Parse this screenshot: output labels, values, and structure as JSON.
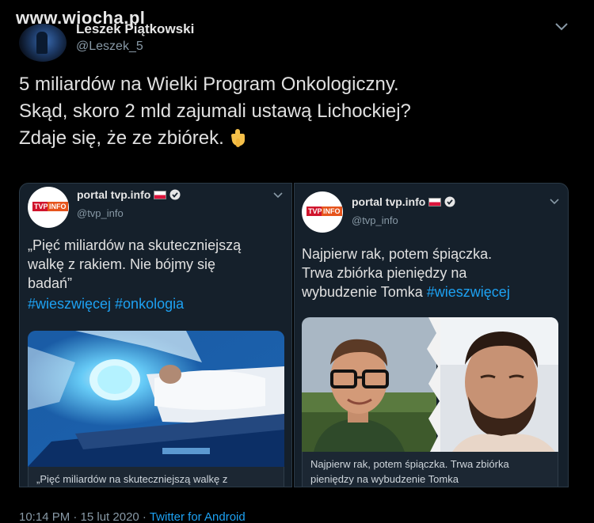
{
  "watermark": {
    "text": "www.wiocha.pl"
  },
  "author": {
    "name": "Leszek Piątkowski",
    "handle": "@Leszek_5"
  },
  "tweet": {
    "lines": [
      "5 miliardów na Wielki Program Onkologiczny.",
      "Skąd, skoro 2 mld zajumali ustawą Lichockiej?",
      "Zdaje się, że ze zbiórek."
    ],
    "emoji": "pointing-down-hand"
  },
  "cards": [
    {
      "name": "portal tvp.info",
      "handle": "@tvp_info",
      "logo_text_a": "TVP",
      "logo_text_b": "INFO",
      "text_lines": [
        "„Pięć miliardów na skuteczniejszą",
        "walkę z rakiem. Nie bójmy się",
        "badań”"
      ],
      "hashtags": "#wieszwięcej #onkologia",
      "caption": "„Pięć miliardów na skuteczniejszą walkę z"
    },
    {
      "name": "portal tvp.info",
      "handle": "@tvp_info",
      "logo_text_a": "TVP",
      "logo_text_b": "INFO",
      "text_lines": [
        "Najpierw rak, potem śpiączka.",
        "Trwa zbiórka pieniędzy na"
      ],
      "text_last": "wybudzenie Tomka",
      "hashtag": "#wieszwięcej",
      "caption_lines": [
        "Najpierw rak, potem śpiączka. Trwa zbiórka",
        "pieniędzy na wybudzenie Tomka"
      ]
    }
  ],
  "footer": {
    "time": "10:14 PM · 15 lut 2020 · ",
    "source": "Twitter for Android"
  },
  "colors": {
    "background": "#000000",
    "card": "#15202b",
    "link": "#1da1f2",
    "muted": "#8899a6",
    "flag_red": "#dc143c"
  }
}
